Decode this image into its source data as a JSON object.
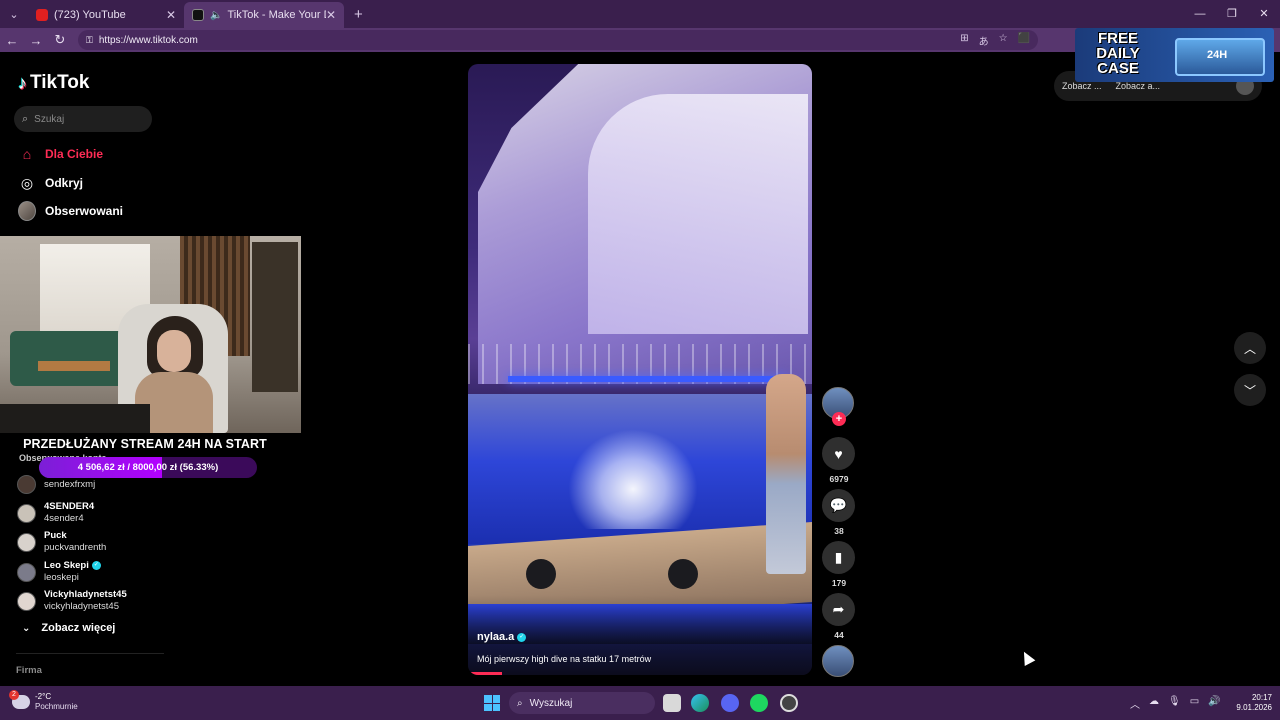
{
  "browser": {
    "tabs": [
      {
        "title": "(723) YouTube",
        "icon": "youtube-icon",
        "active": false
      },
      {
        "title": "TikTok - Make Your Day",
        "icon": "tiktok-icon",
        "active": true
      }
    ],
    "url": "https://www.tiktok.com"
  },
  "sidebar": {
    "logo_text": "TikTok",
    "search_placeholder": "Szukaj",
    "nav": [
      {
        "label": "Dla Ciebie",
        "icon": "home-icon",
        "active": true
      },
      {
        "label": "Odkryj",
        "icon": "compass-icon",
        "active": false
      },
      {
        "label": "Obserwowani",
        "icon": "avatar-icon",
        "active": false
      }
    ],
    "following_label": "Obserwowane konta",
    "following": [
      {
        "name": "",
        "handle": "sendexfrxmj",
        "verified": false
      },
      {
        "name": "4SENDER4",
        "handle": "4sender4",
        "verified": false
      },
      {
        "name": "Puck",
        "handle": "puckvandrenth",
        "verified": false
      },
      {
        "name": "Leo Skepi",
        "handle": "leoskepi",
        "verified": true
      },
      {
        "name": "Vickyhladynetst45",
        "handle": "vickyhladynetst45",
        "verified": false
      }
    ],
    "see_more": "Zobacz więcej",
    "footer_label": "Firma"
  },
  "stream_overlay": {
    "title": "PRZEDŁUŻANY STREAM 24H NA START",
    "goal_text": "4 506,62 zł / 8000,00 zł (56.33%)",
    "goal_fraction": 0.5633
  },
  "video": {
    "author": "nylaa.a",
    "author_verified": true,
    "caption": "Mój pierwszy high dive na statku 17 metrów",
    "progress_fraction": 0.1
  },
  "actions": {
    "likes": "6979",
    "comments": "38",
    "saves": "179",
    "shares": "44"
  },
  "top_right": {
    "items": [
      "Zobacz ...",
      "Zobacz a..."
    ]
  },
  "promo": {
    "text": "FREE DAILY CASE",
    "badge": "24H"
  },
  "taskbar": {
    "weather_temp": "-2°C",
    "weather_cond": "Pochmurnie",
    "weather_badge": "2",
    "search_label": "Wyszukaj",
    "time": "20:17",
    "date": "9.01.2026"
  },
  "colors": {
    "accent": "#fe2c55",
    "chrome": "#3a1f4d",
    "goal": "#9b1ff0"
  }
}
